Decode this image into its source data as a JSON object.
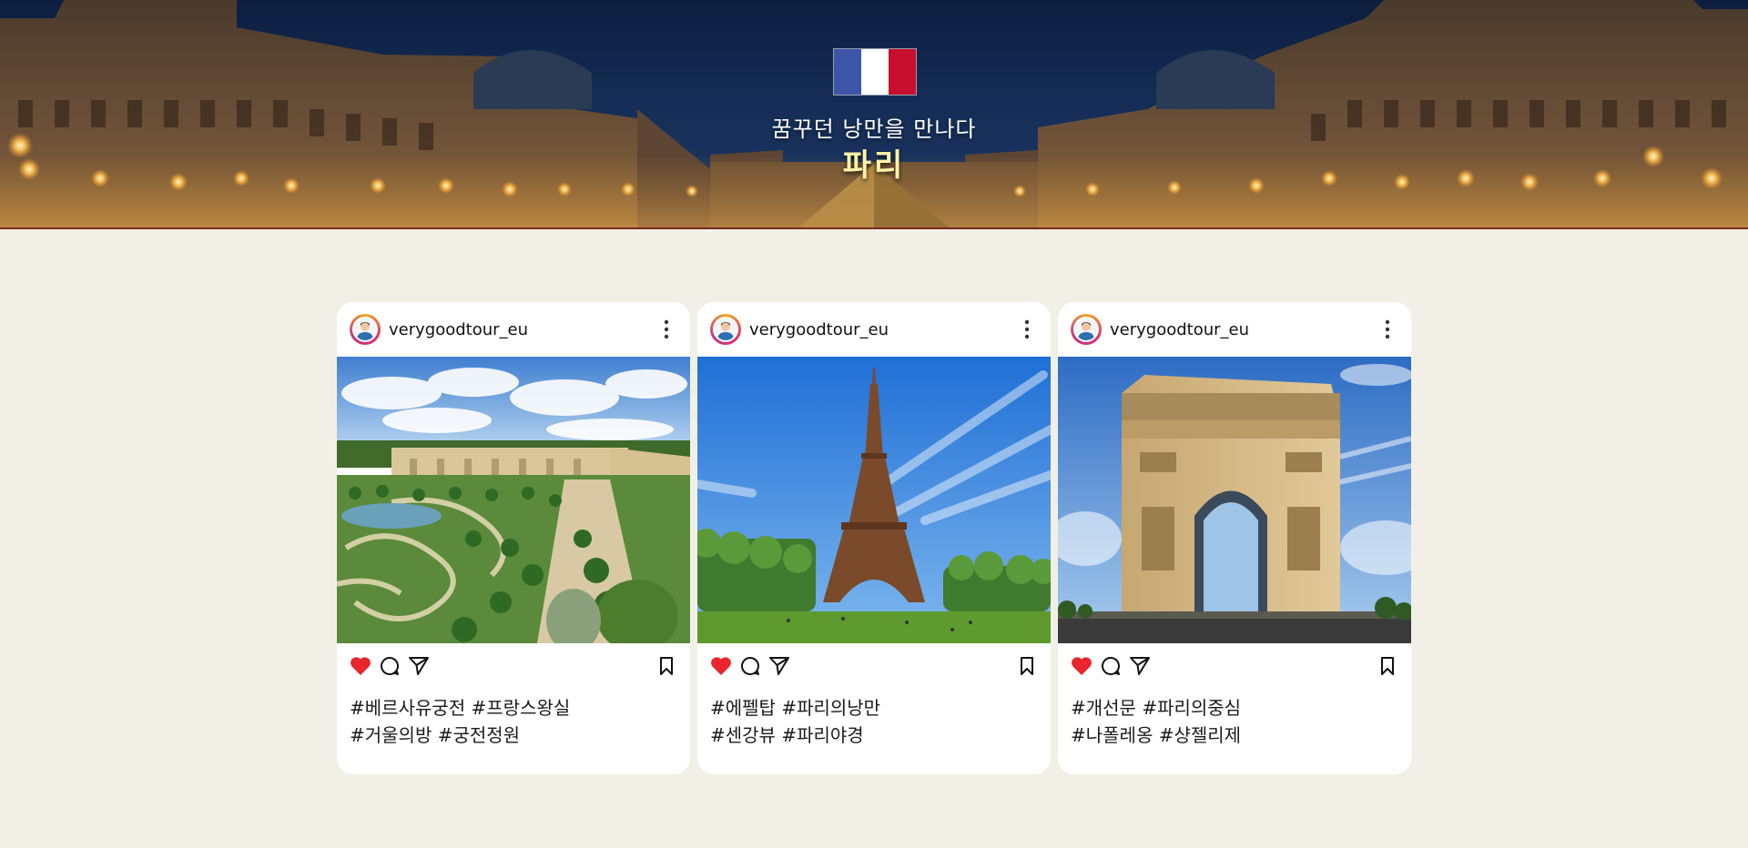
{
  "hero": {
    "subtitle": "꿈꾸던 낭만을 만나다",
    "title": "파리",
    "title_color": "#fff3a8",
    "flag_colors": [
      "#3c55a6",
      "#ffffff",
      "#c8102e"
    ]
  },
  "posts": [
    {
      "username": "verygoodtour_eu",
      "photo": "versailles-garden-photo",
      "tags_line1": "#베르사유궁전 #프랑스왕실",
      "tags_line2": "#거울의방 #궁전정원",
      "liked": true
    },
    {
      "username": "verygoodtour_eu",
      "photo": "eiffel-tower-photo",
      "tags_line1": "#에펠탑 #파리의낭만",
      "tags_line2": "#센강뷰 #파리야경",
      "liked": true
    },
    {
      "username": "verygoodtour_eu",
      "photo": "arc-de-triomphe-photo",
      "tags_line1": "#개선문 #파리의중심",
      "tags_line2": "#나폴레옹 #샹젤리제",
      "liked": true
    }
  ],
  "icons": {
    "like": "heart-icon",
    "comment": "comment-icon",
    "share": "send-icon",
    "save": "bookmark-icon",
    "more": "more-vertical-icon"
  },
  "colors": {
    "page_background": "#f2f0e6",
    "heart": "#e8262c"
  }
}
